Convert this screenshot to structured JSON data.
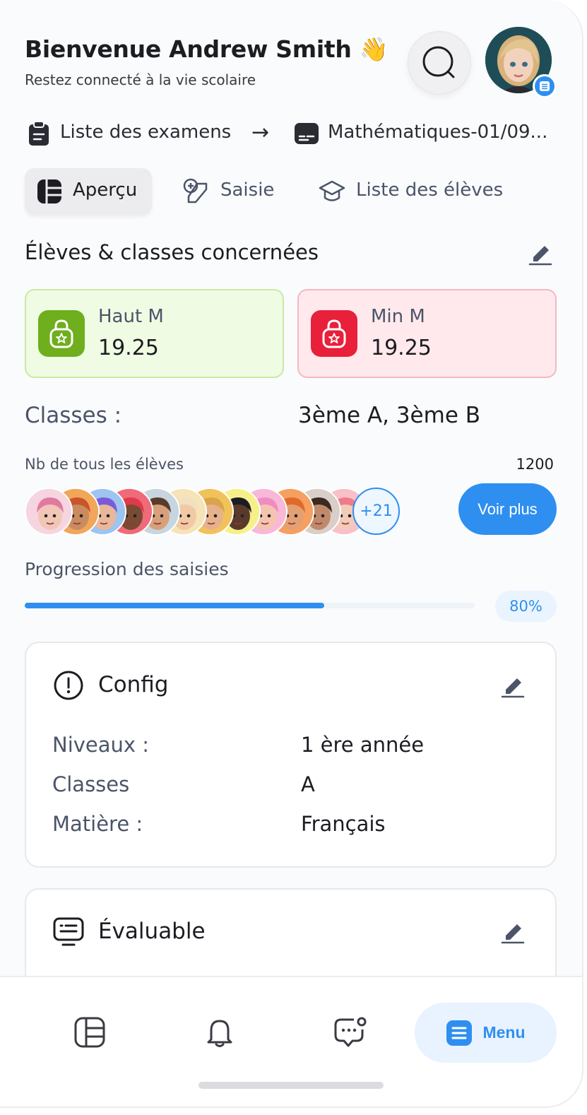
{
  "header": {
    "greeting": "Bienvenue Andrew Smith",
    "greeting_emoji": "👋",
    "subtitle": "Restez connecté à la vie scolaire"
  },
  "breadcrumb": {
    "first": "Liste des examens",
    "arrow": "→",
    "second": "Mathématiques-01/09..."
  },
  "tabs": [
    {
      "label": "Aperçu",
      "active": true
    },
    {
      "label": "Saisie",
      "active": false
    },
    {
      "label": "Liste des élèves",
      "active": false
    }
  ],
  "section_title": "Élèves & classes concernées",
  "stats": {
    "high": {
      "label": "Haut M",
      "value": "19.25"
    },
    "low": {
      "label": "Min M",
      "value": "19.25"
    }
  },
  "classes": {
    "label": "Classes  :",
    "value": "3ème A, 3ème B"
  },
  "students": {
    "label": "Nb de tous les élèves",
    "count": "1200",
    "more": "+21",
    "see_more": "Voir plus"
  },
  "progress": {
    "label": "Progression des saisies",
    "percent": 80,
    "percent_label": "80%"
  },
  "config": {
    "title": "Config",
    "rows": [
      {
        "key": "Niveaux :",
        "value": "1 ère année"
      },
      {
        "key": "Classes",
        "value": "A"
      },
      {
        "key": "Matière :",
        "value": "Français"
      }
    ]
  },
  "evaluable": {
    "title": "Évaluable"
  },
  "bottom_nav": {
    "menu_label": "Menu"
  },
  "colors": {
    "accent": "#2f8ff0",
    "green": "#6fae1d",
    "red": "#e8203a"
  }
}
